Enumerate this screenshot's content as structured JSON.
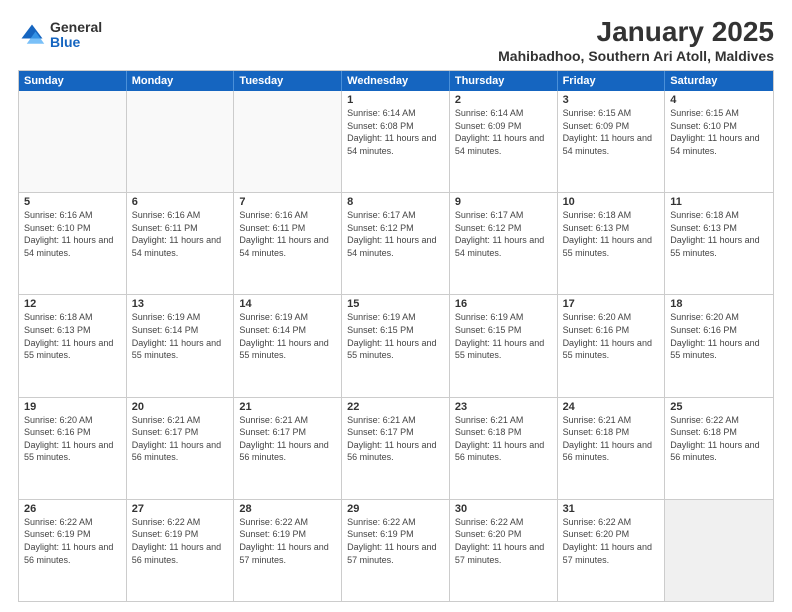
{
  "logo": {
    "general": "General",
    "blue": "Blue"
  },
  "title": "January 2025",
  "subtitle": "Mahibadhoo, Southern Ari Atoll, Maldives",
  "header_days": [
    "Sunday",
    "Monday",
    "Tuesday",
    "Wednesday",
    "Thursday",
    "Friday",
    "Saturday"
  ],
  "weeks": [
    [
      {
        "day": "",
        "sunrise": "",
        "sunset": "",
        "daylight": "",
        "empty": true
      },
      {
        "day": "",
        "sunrise": "",
        "sunset": "",
        "daylight": "",
        "empty": true
      },
      {
        "day": "",
        "sunrise": "",
        "sunset": "",
        "daylight": "",
        "empty": true
      },
      {
        "day": "1",
        "sunrise": "Sunrise: 6:14 AM",
        "sunset": "Sunset: 6:08 PM",
        "daylight": "Daylight: 11 hours and 54 minutes."
      },
      {
        "day": "2",
        "sunrise": "Sunrise: 6:14 AM",
        "sunset": "Sunset: 6:09 PM",
        "daylight": "Daylight: 11 hours and 54 minutes."
      },
      {
        "day": "3",
        "sunrise": "Sunrise: 6:15 AM",
        "sunset": "Sunset: 6:09 PM",
        "daylight": "Daylight: 11 hours and 54 minutes."
      },
      {
        "day": "4",
        "sunrise": "Sunrise: 6:15 AM",
        "sunset": "Sunset: 6:10 PM",
        "daylight": "Daylight: 11 hours and 54 minutes."
      }
    ],
    [
      {
        "day": "5",
        "sunrise": "Sunrise: 6:16 AM",
        "sunset": "Sunset: 6:10 PM",
        "daylight": "Daylight: 11 hours and 54 minutes."
      },
      {
        "day": "6",
        "sunrise": "Sunrise: 6:16 AM",
        "sunset": "Sunset: 6:11 PM",
        "daylight": "Daylight: 11 hours and 54 minutes."
      },
      {
        "day": "7",
        "sunrise": "Sunrise: 6:16 AM",
        "sunset": "Sunset: 6:11 PM",
        "daylight": "Daylight: 11 hours and 54 minutes."
      },
      {
        "day": "8",
        "sunrise": "Sunrise: 6:17 AM",
        "sunset": "Sunset: 6:12 PM",
        "daylight": "Daylight: 11 hours and 54 minutes."
      },
      {
        "day": "9",
        "sunrise": "Sunrise: 6:17 AM",
        "sunset": "Sunset: 6:12 PM",
        "daylight": "Daylight: 11 hours and 54 minutes."
      },
      {
        "day": "10",
        "sunrise": "Sunrise: 6:18 AM",
        "sunset": "Sunset: 6:13 PM",
        "daylight": "Daylight: 11 hours and 55 minutes."
      },
      {
        "day": "11",
        "sunrise": "Sunrise: 6:18 AM",
        "sunset": "Sunset: 6:13 PM",
        "daylight": "Daylight: 11 hours and 55 minutes."
      }
    ],
    [
      {
        "day": "12",
        "sunrise": "Sunrise: 6:18 AM",
        "sunset": "Sunset: 6:13 PM",
        "daylight": "Daylight: 11 hours and 55 minutes."
      },
      {
        "day": "13",
        "sunrise": "Sunrise: 6:19 AM",
        "sunset": "Sunset: 6:14 PM",
        "daylight": "Daylight: 11 hours and 55 minutes."
      },
      {
        "day": "14",
        "sunrise": "Sunrise: 6:19 AM",
        "sunset": "Sunset: 6:14 PM",
        "daylight": "Daylight: 11 hours and 55 minutes."
      },
      {
        "day": "15",
        "sunrise": "Sunrise: 6:19 AM",
        "sunset": "Sunset: 6:15 PM",
        "daylight": "Daylight: 11 hours and 55 minutes."
      },
      {
        "day": "16",
        "sunrise": "Sunrise: 6:19 AM",
        "sunset": "Sunset: 6:15 PM",
        "daylight": "Daylight: 11 hours and 55 minutes."
      },
      {
        "day": "17",
        "sunrise": "Sunrise: 6:20 AM",
        "sunset": "Sunset: 6:16 PM",
        "daylight": "Daylight: 11 hours and 55 minutes."
      },
      {
        "day": "18",
        "sunrise": "Sunrise: 6:20 AM",
        "sunset": "Sunset: 6:16 PM",
        "daylight": "Daylight: 11 hours and 55 minutes."
      }
    ],
    [
      {
        "day": "19",
        "sunrise": "Sunrise: 6:20 AM",
        "sunset": "Sunset: 6:16 PM",
        "daylight": "Daylight: 11 hours and 55 minutes."
      },
      {
        "day": "20",
        "sunrise": "Sunrise: 6:21 AM",
        "sunset": "Sunset: 6:17 PM",
        "daylight": "Daylight: 11 hours and 56 minutes."
      },
      {
        "day": "21",
        "sunrise": "Sunrise: 6:21 AM",
        "sunset": "Sunset: 6:17 PM",
        "daylight": "Daylight: 11 hours and 56 minutes."
      },
      {
        "day": "22",
        "sunrise": "Sunrise: 6:21 AM",
        "sunset": "Sunset: 6:17 PM",
        "daylight": "Daylight: 11 hours and 56 minutes."
      },
      {
        "day": "23",
        "sunrise": "Sunrise: 6:21 AM",
        "sunset": "Sunset: 6:18 PM",
        "daylight": "Daylight: 11 hours and 56 minutes."
      },
      {
        "day": "24",
        "sunrise": "Sunrise: 6:21 AM",
        "sunset": "Sunset: 6:18 PM",
        "daylight": "Daylight: 11 hours and 56 minutes."
      },
      {
        "day": "25",
        "sunrise": "Sunrise: 6:22 AM",
        "sunset": "Sunset: 6:18 PM",
        "daylight": "Daylight: 11 hours and 56 minutes."
      }
    ],
    [
      {
        "day": "26",
        "sunrise": "Sunrise: 6:22 AM",
        "sunset": "Sunset: 6:19 PM",
        "daylight": "Daylight: 11 hours and 56 minutes."
      },
      {
        "day": "27",
        "sunrise": "Sunrise: 6:22 AM",
        "sunset": "Sunset: 6:19 PM",
        "daylight": "Daylight: 11 hours and 56 minutes."
      },
      {
        "day": "28",
        "sunrise": "Sunrise: 6:22 AM",
        "sunset": "Sunset: 6:19 PM",
        "daylight": "Daylight: 11 hours and 57 minutes."
      },
      {
        "day": "29",
        "sunrise": "Sunrise: 6:22 AM",
        "sunset": "Sunset: 6:19 PM",
        "daylight": "Daylight: 11 hours and 57 minutes."
      },
      {
        "day": "30",
        "sunrise": "Sunrise: 6:22 AM",
        "sunset": "Sunset: 6:20 PM",
        "daylight": "Daylight: 11 hours and 57 minutes."
      },
      {
        "day": "31",
        "sunrise": "Sunrise: 6:22 AM",
        "sunset": "Sunset: 6:20 PM",
        "daylight": "Daylight: 11 hours and 57 minutes."
      },
      {
        "day": "",
        "sunrise": "",
        "sunset": "",
        "daylight": "",
        "empty": true
      }
    ]
  ]
}
